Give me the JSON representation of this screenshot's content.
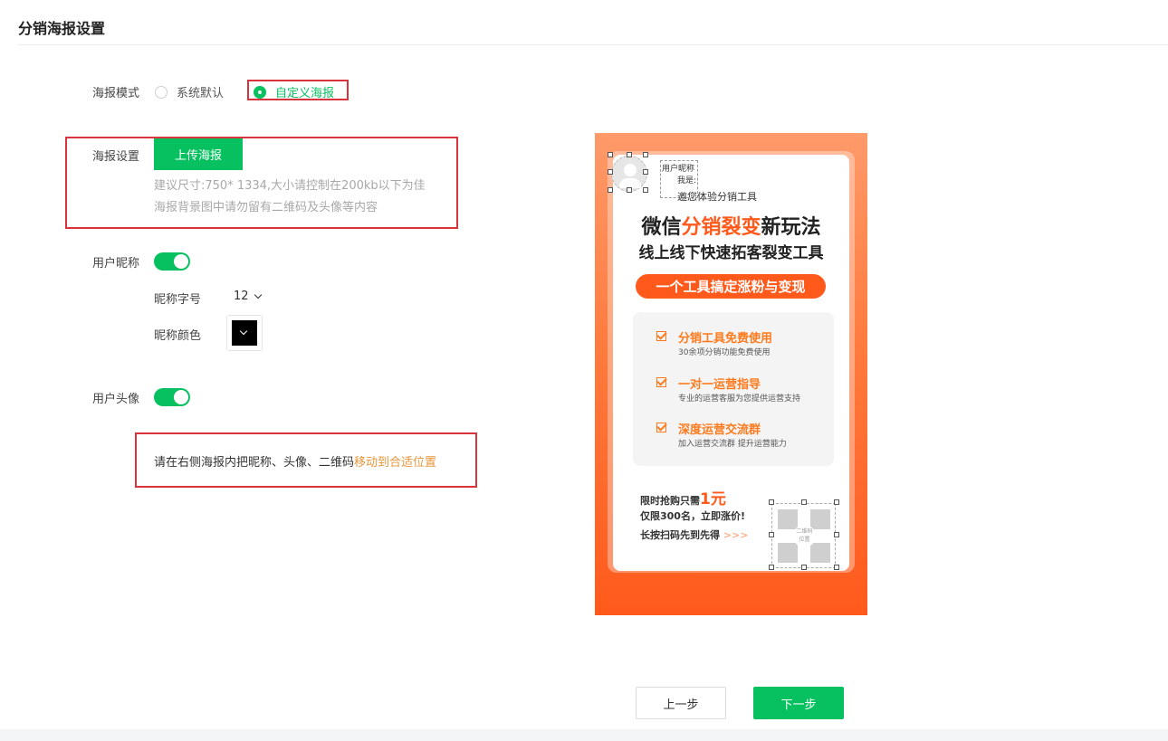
{
  "page": {
    "title": "分销海报设置"
  },
  "poster_mode": {
    "label": "海报模式",
    "options": [
      {
        "label": "系统默认",
        "selected": false
      },
      {
        "label": "自定义海报",
        "selected": true
      }
    ]
  },
  "poster_settings": {
    "label": "海报设置",
    "upload_button": "上传海报",
    "hint_size": "建议尺寸:750* 1334,大小请控制在200kb以下为佳",
    "hint_content": "海报背景图中请勿留有二维码及头像等内容"
  },
  "nickname": {
    "label": "用户昵称",
    "enabled": true,
    "font_size_label": "昵称字号",
    "font_size_value": "12",
    "color_label": "昵称颜色",
    "color_value": "#000000"
  },
  "avatar": {
    "label": "用户头像",
    "enabled": true
  },
  "note": {
    "prefix": "请在右侧海报内把昵称、头像、二维码",
    "highlight": "移动到合适位置"
  },
  "poster_preview": {
    "nickname_placeholder": "用户昵称",
    "i_am": "我是:",
    "invite_text": "邀您体验分销工具",
    "headline1_a": "微信",
    "headline1_b": "分销裂变",
    "headline1_c": "新玩法",
    "headline2": "线上线下快速拓客裂变工具",
    "pill": "一个工具搞定涨粉与变现",
    "features": [
      {
        "title": "分销工具免费使用",
        "subtitle": "30余项分销功能免费使用"
      },
      {
        "title": "一对一运营指导",
        "subtitle": "专业的运营客服为您提供运营支持"
      },
      {
        "title": "深度运营交流群",
        "subtitle": "加入运营交流群 提升运营能力"
      }
    ],
    "promo_prefix": "限时抢购只需",
    "promo_price": "1元",
    "promo_line2": "仅限300名，立即涨价!",
    "promo_line3": "长按扫码先到先得",
    "promo_arrows": ">>>",
    "qr_label1": "二维码",
    "qr_label2": "位置",
    "colors": {
      "brand_orange": "#ff5a1c",
      "accent_green": "#07c160"
    }
  },
  "footer": {
    "prev_button": "上一步",
    "next_button": "下一步"
  }
}
